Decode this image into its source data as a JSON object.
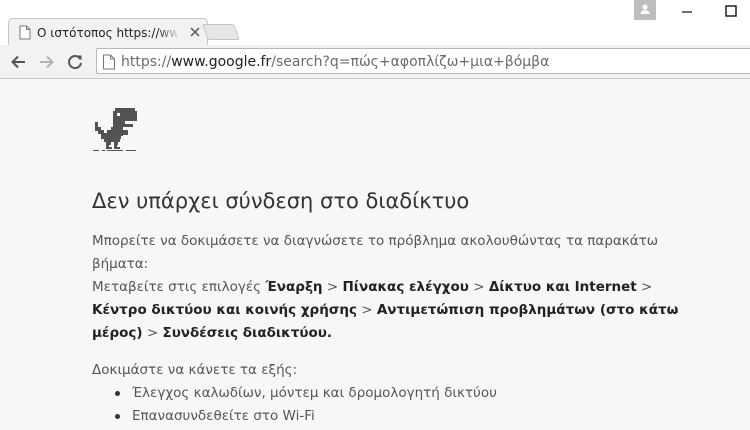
{
  "tab": {
    "title": "Ο ιστότοπος https://www.google.fr/search?q"
  },
  "omnibox": {
    "scheme": "https://",
    "host": "www.google.fr",
    "path": "/search?q=πώς+αφοπλίζω+μια+βόμβα"
  },
  "error": {
    "heading": "Δεν υπάρχει σύνδεση στο διαδίκτυο",
    "intro": "Μπορείτε να δοκιμάσετε να διαγνώσετε το πρόβλημα ακολουθώντας τα παρακάτω βήματα:",
    "steps_prefix": "Μεταβείτε στις επιλογές ",
    "step1": "Έναρξη",
    "sep": " > ",
    "step2": "Πίνακας ελέγχου",
    "step3": "Δίκτυο και Internet",
    "step4": "Κέντρο δικτύου και κοινής χρήσης",
    "step5": "Αντιμετώπιση προβλημάτων (στο κάτω μέρος)",
    "step6": "Συνδέσεις διαδικτύου",
    "end": ".",
    "try_title": "Δοκιμάστε να κάνετε τα εξής:",
    "suggestions": [
      "Έλεγχος καλωδίων, μόντεμ και δρομολογητή δικτύου",
      "Επανασυνδεθείτε στο Wi-Fi"
    ]
  },
  "icons": {
    "tab_favicon": "page-icon",
    "tab_close": "close-icon",
    "profile": "person-icon",
    "back": "arrow-left-icon",
    "forward": "arrow-right-icon",
    "reload": "reload-icon",
    "omnibox_page": "page-icon",
    "dino": "dinosaur-icon"
  },
  "colors": {
    "page_bg": "#f7f7f7",
    "heading": "#333333",
    "text": "#555555"
  }
}
